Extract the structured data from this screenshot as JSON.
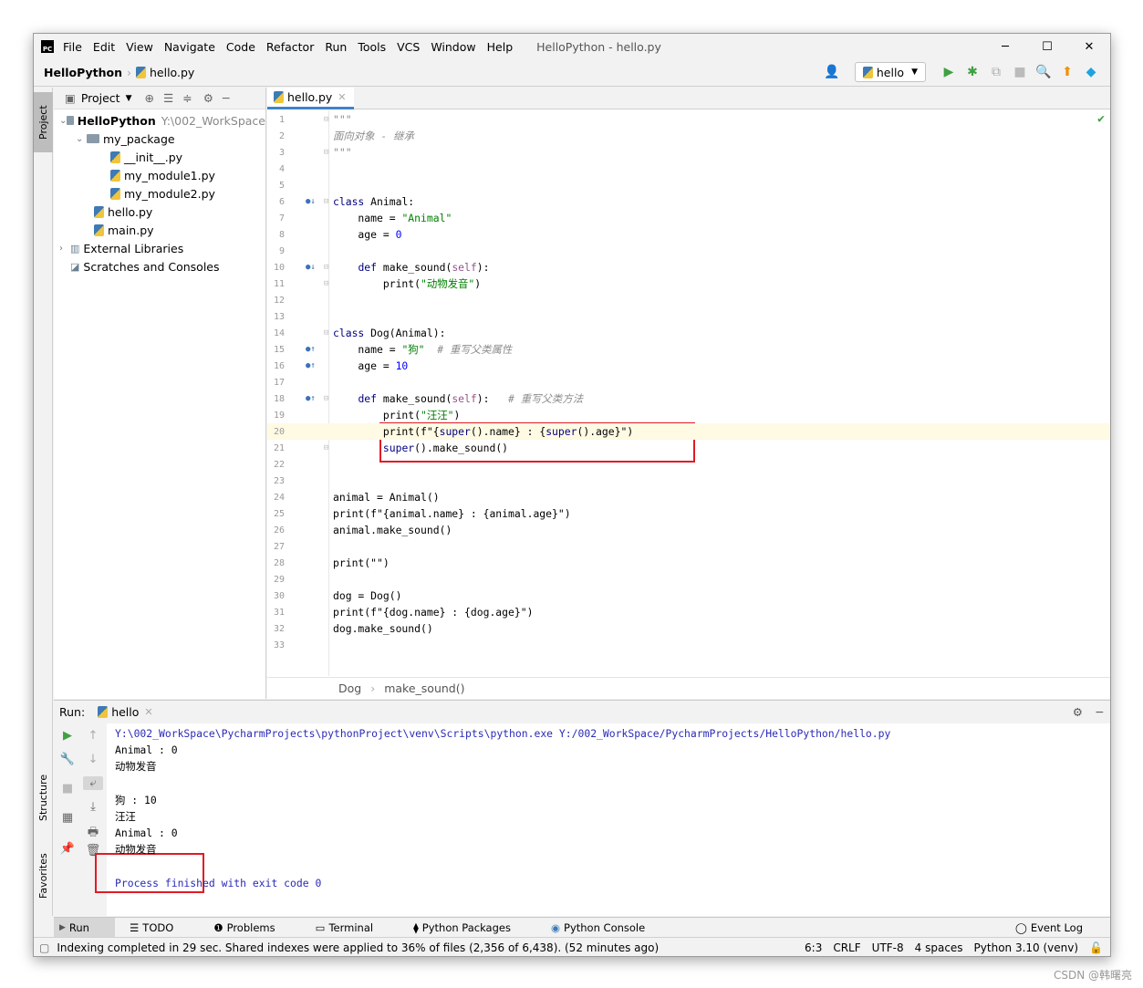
{
  "menu": [
    "File",
    "Edit",
    "View",
    "Navigate",
    "Code",
    "Refactor",
    "Run",
    "Tools",
    "VCS",
    "Window",
    "Help"
  ],
  "window_title": "HelloPython - hello.py",
  "nav": {
    "project": "HelloPython",
    "file": "hello.py",
    "run_config": "hello"
  },
  "side_tabs": {
    "project": "Project",
    "structure": "Structure",
    "favorites": "Favorites"
  },
  "project_panel": {
    "title": "Project",
    "tree": [
      {
        "label": "HelloPython",
        "extra": "Y:\\002_WorkSpace",
        "kind": "root"
      },
      {
        "label": "my_package",
        "kind": "folder"
      },
      {
        "label": "__init__.py",
        "kind": "py"
      },
      {
        "label": "my_module1.py",
        "kind": "py"
      },
      {
        "label": "my_module2.py",
        "kind": "py"
      },
      {
        "label": "hello.py",
        "kind": "py"
      },
      {
        "label": "main.py",
        "kind": "py"
      },
      {
        "label": "External Libraries",
        "kind": "lib"
      },
      {
        "label": "Scratches and Consoles",
        "kind": "scratch"
      }
    ]
  },
  "editor": {
    "tab": "hello.py",
    "breadcrumb": [
      "Dog",
      "make_sound()"
    ],
    "lines": [
      [
        [
          "\"\"\"",
          "cm"
        ]
      ],
      [
        [
          "面向对象 - 继承",
          "cm"
        ]
      ],
      [
        [
          "\"\"\"",
          "cm"
        ]
      ],
      [],
      [],
      [
        [
          "class ",
          "kw"
        ],
        [
          "Animal:",
          ""
        ]
      ],
      [
        [
          "    name = ",
          ""
        ],
        [
          "\"Animal\"",
          "str"
        ]
      ],
      [
        [
          "    age = ",
          ""
        ],
        [
          "0",
          "num"
        ]
      ],
      [],
      [
        [
          "    ",
          ""
        ],
        [
          "def ",
          "kw"
        ],
        [
          "make_sound(",
          ""
        ],
        [
          "self",
          "sf"
        ],
        [
          "):",
          ""
        ]
      ],
      [
        [
          "        print(",
          ""
        ],
        [
          "\"动物发音\"",
          "str"
        ],
        [
          ")",
          ""
        ]
      ],
      [],
      [],
      [
        [
          "class ",
          "kw"
        ],
        [
          "Dog(Animal):",
          ""
        ]
      ],
      [
        [
          "    name = ",
          ""
        ],
        [
          "\"狗\"",
          "str"
        ],
        [
          "  # 重写父类属性",
          "cm"
        ]
      ],
      [
        [
          "    age = ",
          ""
        ],
        [
          "10",
          "num"
        ]
      ],
      [],
      [
        [
          "    ",
          ""
        ],
        [
          "def ",
          "kw"
        ],
        [
          "make_sound(",
          ""
        ],
        [
          "self",
          "sf"
        ],
        [
          "):   ",
          ""
        ],
        [
          "# 重写父类方法",
          "cm"
        ]
      ],
      [
        [
          "        print(",
          ""
        ],
        [
          "\"汪汪\"",
          "str"
        ],
        [
          ")",
          ""
        ]
      ],
      [
        [
          "        print(f\"{",
          ""
        ],
        [
          "super",
          "kw"
        ],
        [
          "().name} : {",
          ""
        ],
        [
          "super",
          "kw"
        ],
        [
          "().age}\")",
          ""
        ]
      ],
      [
        [
          "        ",
          ""
        ],
        [
          "super",
          "kw"
        ],
        [
          "().make_sound()",
          ""
        ]
      ],
      [],
      [],
      [
        [
          "animal = Animal()",
          ""
        ]
      ],
      [
        [
          "print(f\"{animal.name} : {animal.age}\")",
          ""
        ]
      ],
      [
        [
          "animal.make_sound()",
          ""
        ]
      ],
      [],
      [
        [
          "print(\"\")",
          ""
        ]
      ],
      [],
      [
        [
          "dog = Dog()",
          ""
        ]
      ],
      [
        [
          "print(f\"{dog.name} : {dog.age}\")",
          ""
        ]
      ],
      [
        [
          "dog.make_sound()",
          ""
        ]
      ],
      []
    ]
  },
  "run": {
    "label": "Run:",
    "tab": "hello",
    "output": [
      [
        "Y:\\002_WorkSpace\\PycharmProjects\\pythonProject\\venv\\Scripts\\python.exe Y:/002_WorkSpace/PycharmProjects/HelloPython/hello.py",
        "blue"
      ],
      [
        "Animal : 0",
        ""
      ],
      [
        "动物发音",
        ""
      ],
      [
        "",
        ""
      ],
      [
        "狗 : 10",
        ""
      ],
      [
        "汪汪",
        ""
      ],
      [
        "Animal : 0",
        ""
      ],
      [
        "动物发音",
        ""
      ],
      [
        "",
        ""
      ],
      [
        "Process finished with exit code 0",
        "blue"
      ]
    ]
  },
  "bottom_tabs": [
    "Run",
    "TODO",
    "Problems",
    "Terminal",
    "Python Packages",
    "Python Console"
  ],
  "event_log": "Event Log",
  "status": {
    "message": "Indexing completed in 29 sec. Shared indexes were applied to 36% of files (2,356 of 6,438). (52 minutes ago)",
    "position": "6:3",
    "line_sep": "CRLF",
    "encoding": "UTF-8",
    "indent": "4 spaces",
    "interpreter": "Python 3.10 (venv)"
  },
  "watermark": "CSDN @韩曙亮",
  "colors": {
    "accent": "#4083c9",
    "highlight_box": "#e01b24"
  }
}
